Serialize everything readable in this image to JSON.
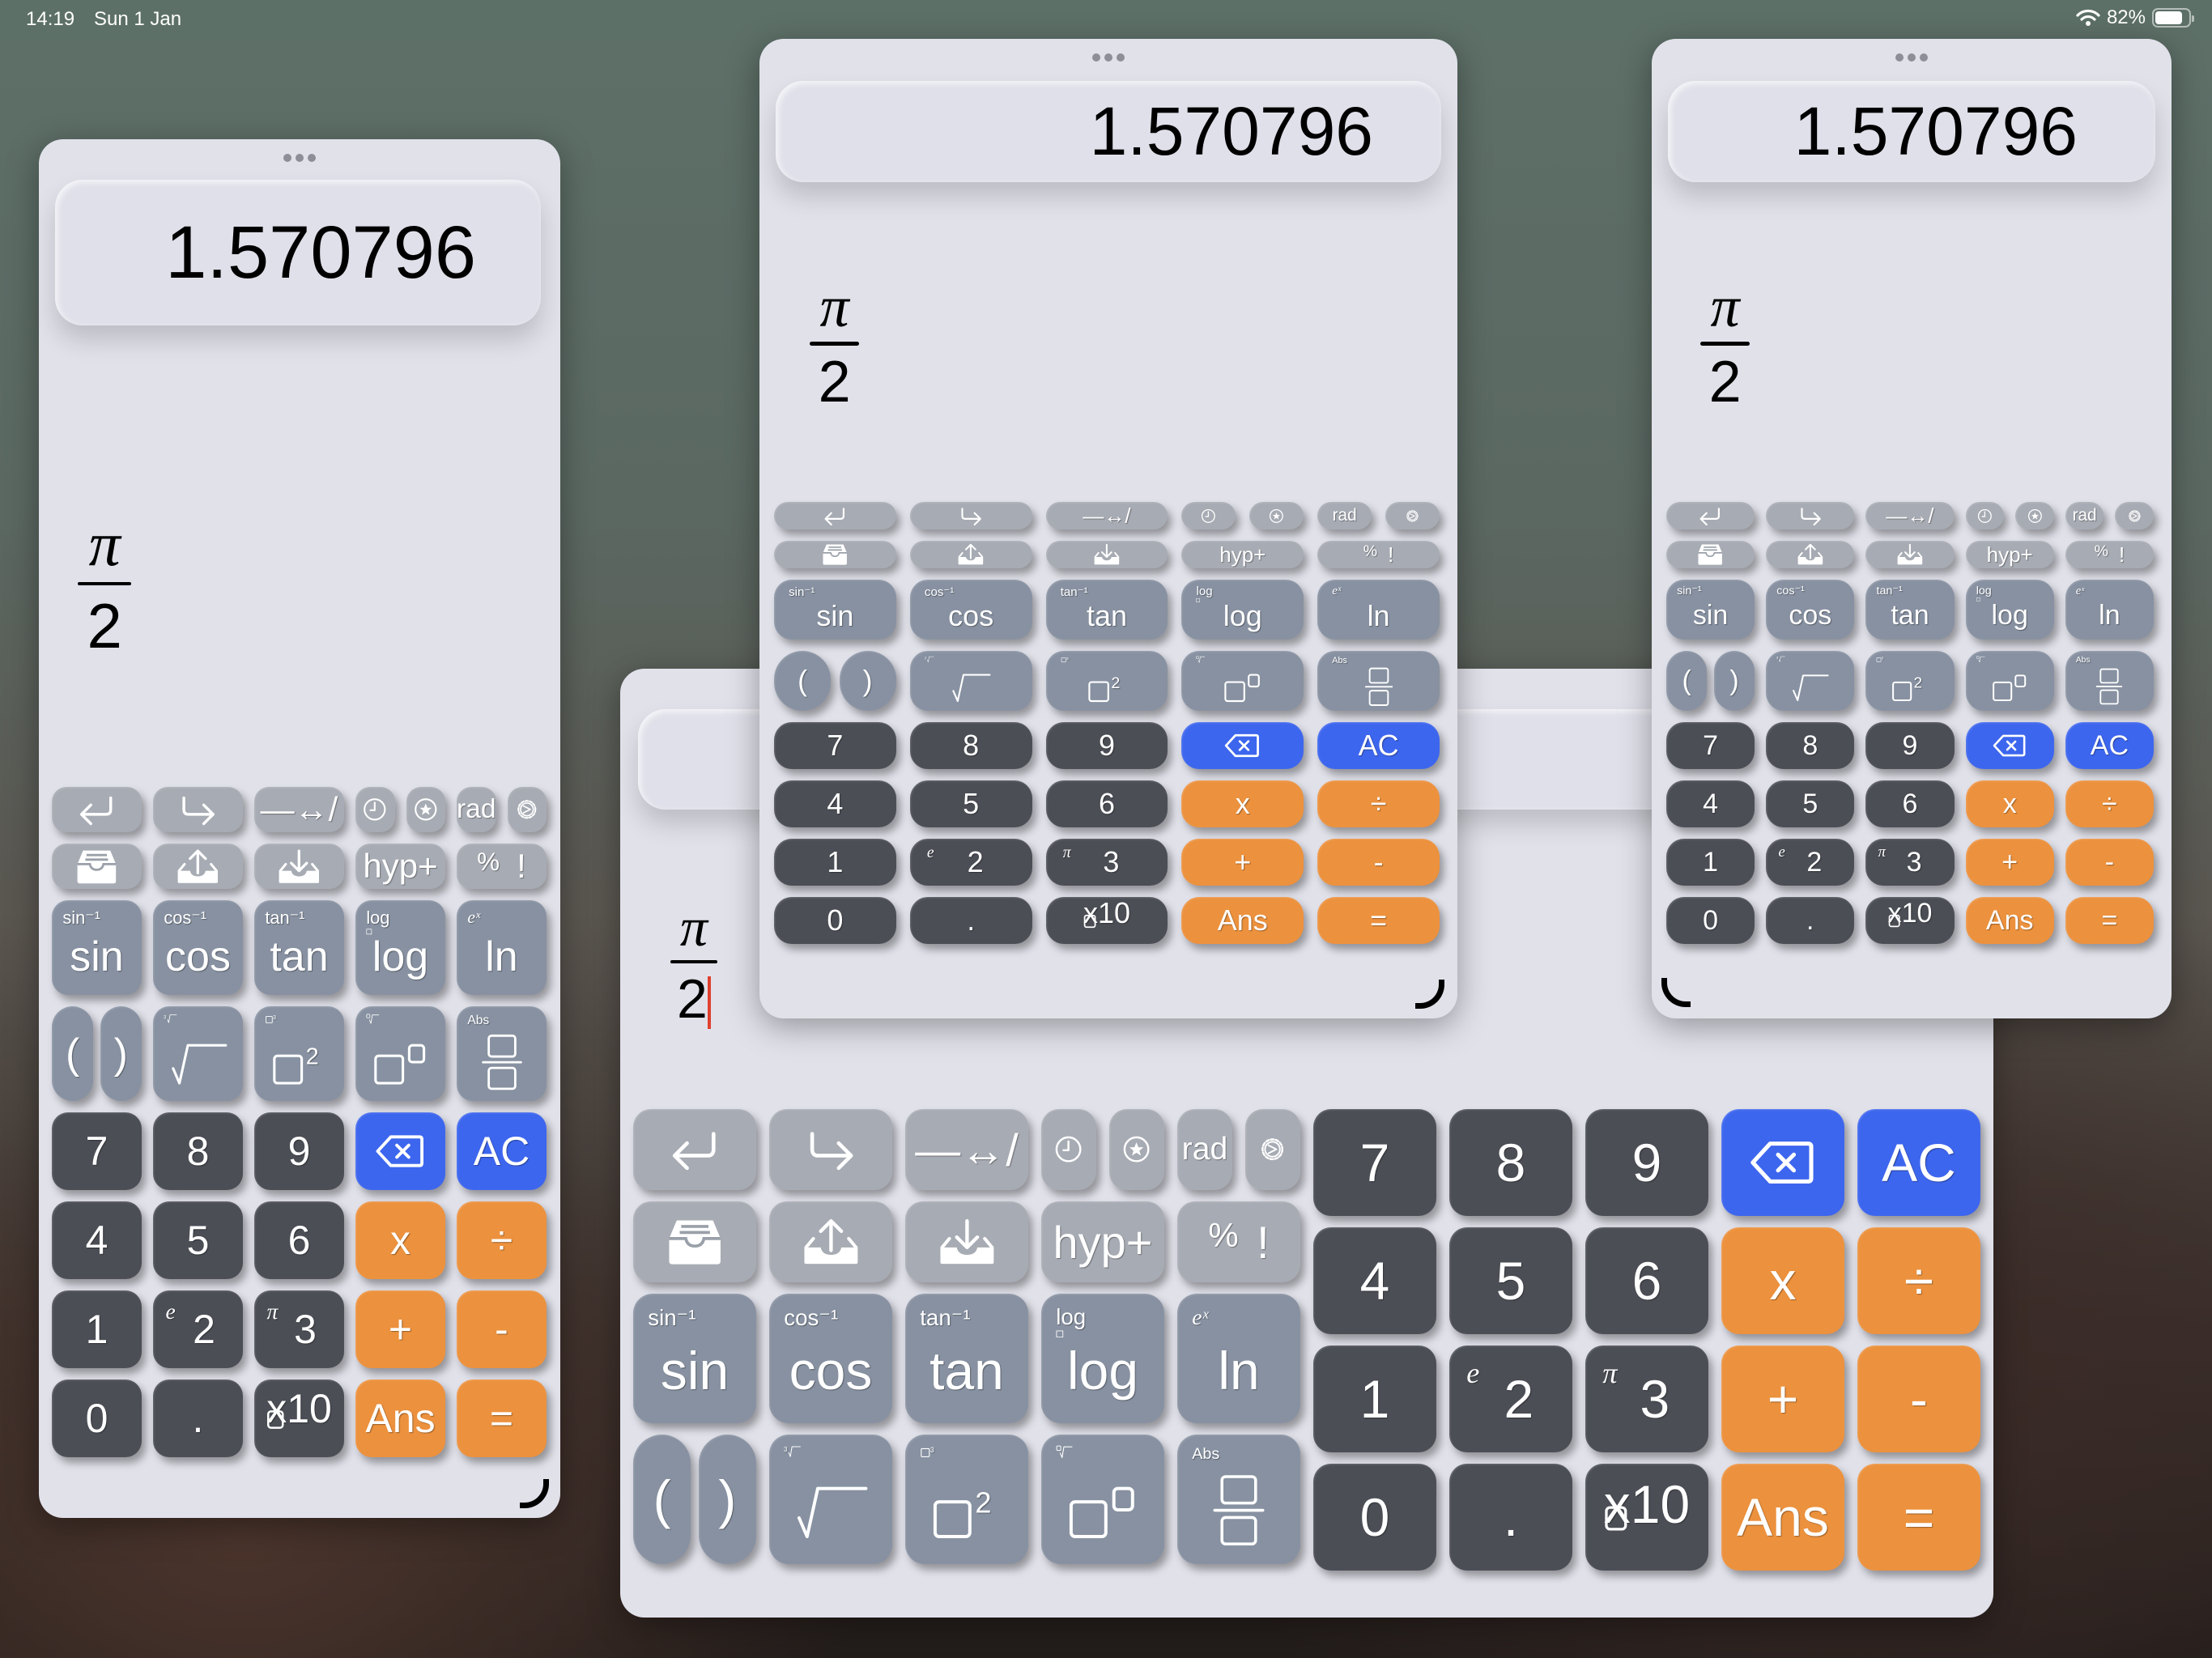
{
  "status_bar": {
    "time": "14:19",
    "date": "Sun 1 Jan",
    "wifi_icon": "wifi-icon",
    "battery_percent_label": "82%",
    "battery_level": 0.82
  },
  "colors": {
    "key_light": "#a7abb3",
    "key_function": "#8791a1",
    "key_digit": "#4b4e55",
    "key_clear": "#3d66ee",
    "key_operator": "#ec913d",
    "window_bg": "#e1e1ea",
    "caret": "#e04030"
  },
  "calculator": {
    "result": "1.570796",
    "big_window_result_visible": "1",
    "expression": {
      "numerator": "π",
      "denominator": "2"
    },
    "toolbar_row1": [
      {
        "id": "undo",
        "icon": "undo-arrow-icon"
      },
      {
        "id": "redo",
        "icon": "redo-arrow-icon"
      },
      {
        "id": "fraction-toggle",
        "label": "—↔/"
      },
      {
        "id": "history",
        "icon": "clock-icon"
      },
      {
        "id": "favorites",
        "icon": "star-circle-icon"
      },
      {
        "id": "angle-mode",
        "label": "rad"
      },
      {
        "id": "settings",
        "icon": "gear-icon"
      }
    ],
    "toolbar_row2": [
      {
        "id": "memory-tray",
        "icon": "tray-icon"
      },
      {
        "id": "memory-store",
        "icon": "tray-upload-icon"
      },
      {
        "id": "memory-recall",
        "icon": "tray-download-icon"
      },
      {
        "id": "hyp",
        "label": "hyp+"
      },
      {
        "id": "percent-factorial",
        "label_a": "%",
        "label_b": "!"
      }
    ],
    "trig_row": [
      {
        "id": "sin",
        "label": "sin",
        "alt": "sin⁻¹"
      },
      {
        "id": "cos",
        "label": "cos",
        "alt": "cos⁻¹"
      },
      {
        "id": "tan",
        "label": "tan",
        "alt": "tan⁻¹"
      },
      {
        "id": "log",
        "label": "log",
        "alt": "log□"
      },
      {
        "id": "ln",
        "label": "ln",
        "alt": "eˣ"
      }
    ],
    "struct_row": [
      {
        "id": "open-paren",
        "label": "("
      },
      {
        "id": "close-paren",
        "label": ")"
      },
      {
        "id": "sqrt",
        "label": "√",
        "alt": "∛"
      },
      {
        "id": "square",
        "label": "□²",
        "alt": "□³"
      },
      {
        "id": "power",
        "label": "□^□",
        "alt": "□√"
      },
      {
        "id": "fraction",
        "label": "□/□",
        "alt": "Abs"
      }
    ],
    "number_rows": [
      [
        {
          "id": "7",
          "label": "7",
          "type": "digit"
        },
        {
          "id": "8",
          "label": "8",
          "type": "digit"
        },
        {
          "id": "9",
          "label": "9",
          "type": "digit"
        },
        {
          "id": "backspace",
          "icon": "backspace-icon",
          "type": "clear"
        },
        {
          "id": "ac",
          "label": "AC",
          "type": "clear"
        }
      ],
      [
        {
          "id": "4",
          "label": "4",
          "type": "digit"
        },
        {
          "id": "5",
          "label": "5",
          "type": "digit"
        },
        {
          "id": "6",
          "label": "6",
          "type": "digit"
        },
        {
          "id": "multiply",
          "label": "x",
          "type": "operator"
        },
        {
          "id": "divide",
          "label": "÷",
          "type": "operator"
        }
      ],
      [
        {
          "id": "1",
          "label": "1",
          "type": "digit"
        },
        {
          "id": "2",
          "label": "2",
          "alt": "e",
          "type": "digit"
        },
        {
          "id": "3",
          "label": "3",
          "alt": "π",
          "type": "digit"
        },
        {
          "id": "plus",
          "label": "+",
          "type": "operator"
        },
        {
          "id": "minus",
          "label": "-",
          "type": "operator"
        }
      ],
      [
        {
          "id": "0",
          "label": "0",
          "type": "digit"
        },
        {
          "id": "decimal",
          "label": ".",
          "type": "digit"
        },
        {
          "id": "exp10",
          "label": "x10",
          "type": "digit"
        },
        {
          "id": "ans",
          "label": "Ans",
          "type": "operator"
        },
        {
          "id": "equals",
          "label": "=",
          "type": "operator"
        }
      ]
    ]
  }
}
